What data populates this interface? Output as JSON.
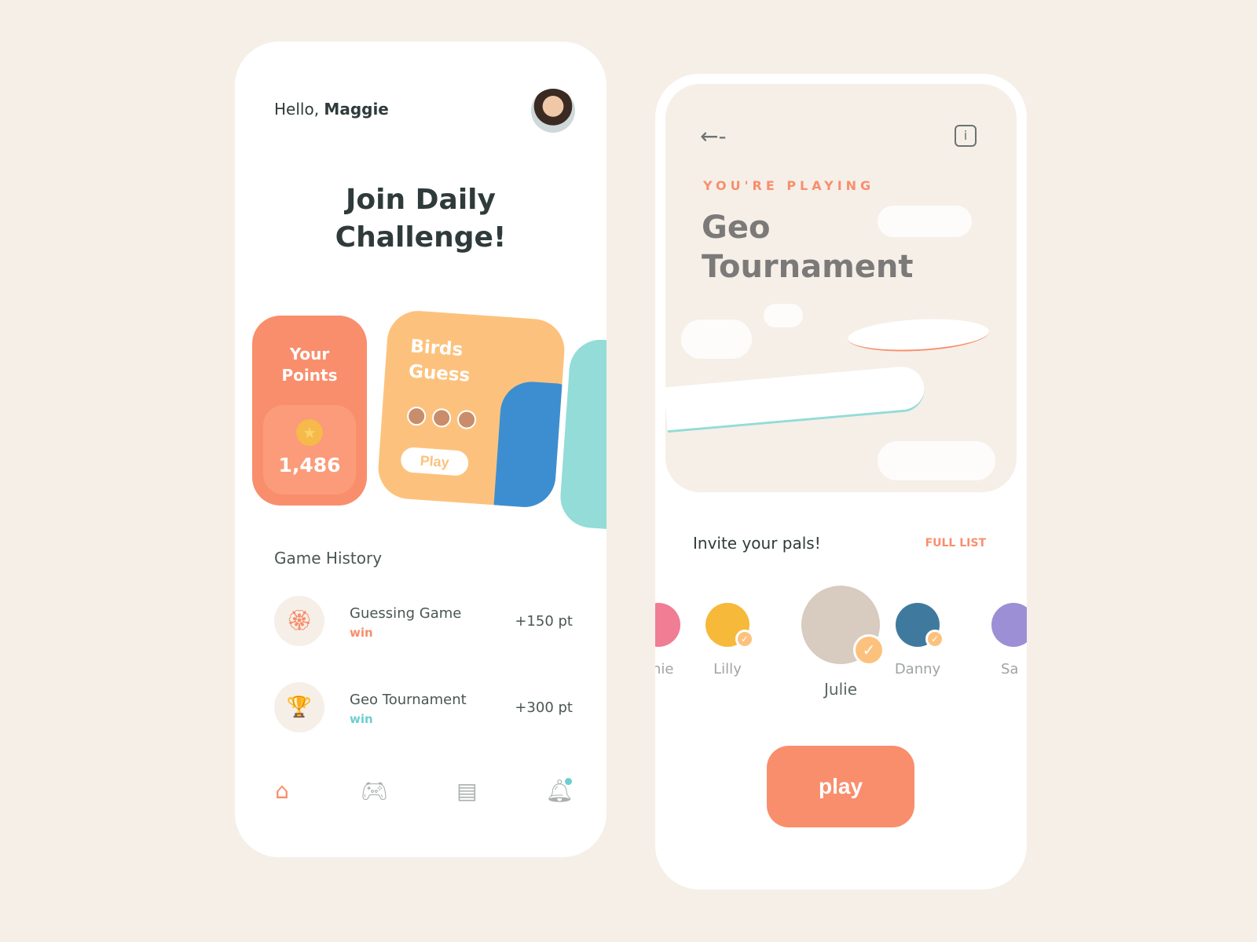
{
  "home": {
    "greeting": "Hello,",
    "user": "Maggie",
    "title_line1": "Join Daily",
    "title_line2": "Challenge!",
    "points": {
      "label_line1": "Your",
      "label_line2": "Points",
      "value": "1,486"
    },
    "birds": {
      "title_line1": "Birds",
      "title_line2": "Guess",
      "play": "Play"
    },
    "history_title": "Game History",
    "history": [
      {
        "name": "Guessing Game",
        "status": "win",
        "points": "+150 pt",
        "icon": "award-icon",
        "color": "#f98e6c"
      },
      {
        "name": "Geo Tournament",
        "status": "win",
        "points": "+300 pt",
        "icon": "trophy-icon",
        "color": "#6ccfd0"
      }
    ],
    "nav": [
      {
        "icon": "home-icon",
        "active": true
      },
      {
        "icon": "gamepad-icon"
      },
      {
        "icon": "store-icon"
      },
      {
        "icon": "bell-icon",
        "badge": true
      }
    ]
  },
  "game": {
    "eyebrow": "YOU'RE PLAYING",
    "title_line1": "Geo",
    "title_line2": "Tournament",
    "invite": "Invite your pals!",
    "full_list": "FULL LIST",
    "pals": [
      {
        "name": "phie",
        "color": "#ef7d93"
      },
      {
        "name": "Lilly",
        "color": "#f6b93a",
        "checked": true
      },
      {
        "name": "Julie",
        "color": "#d8cbbf",
        "checked": true,
        "selected": true
      },
      {
        "name": "Danny",
        "color": "#3f7a9e",
        "checked": true
      },
      {
        "name": "Sa",
        "color": "#9d8fd6"
      }
    ],
    "play": "play"
  },
  "colors": {
    "accent": "#f98e6c",
    "yellow": "#fcc27d",
    "teal": "#93dcd8",
    "bg": "#f5efe8"
  }
}
